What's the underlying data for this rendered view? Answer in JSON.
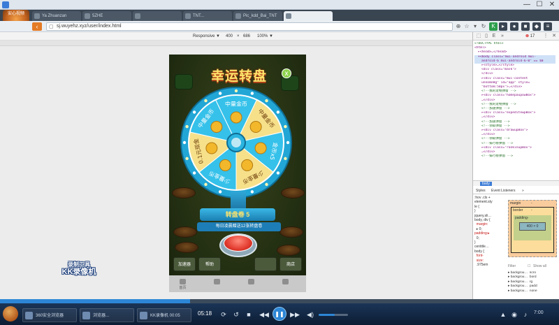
{
  "os": {
    "title_left": "",
    "win_controls": [
      "—",
      "☐",
      "✕"
    ]
  },
  "browser": {
    "logo_line1": "安心视频",
    "tabs": [
      {
        "label": "Ya Zhuanzan"
      },
      {
        "label": "5ZHE"
      },
      {
        "label": ""
      },
      {
        "label": "TNT..."
      },
      {
        "label": "Pic_kdd_Bai_TNT"
      },
      {
        "label": ""
      }
    ],
    "url": "sj.wuyehz.xyz/user/index.html",
    "back_label": "‹",
    "fwd_label": "›"
  },
  "device_toolbar": {
    "preset": "Responsive ▼",
    "width": "400",
    "times": "×",
    "height": "686",
    "zoom": "100% ▼"
  },
  "game": {
    "title": "幸运转盘",
    "close_label": "x",
    "segments": [
      "中量金币",
      "中量金币",
      "金币x5",
      "少量金币",
      "少量金币",
      "0.1元现金",
      "中量金币"
    ],
    "pointer_label": "",
    "stage_label": "转盘卷 5",
    "hint": "每日凌晨赠送12张转盘卷",
    "bottom_buttons": [
      "加速器",
      "帮助",
      "",
      "",
      "商店"
    ],
    "nav": [
      "首页",
      "",
      "",
      ""
    ]
  },
  "watermark": {
    "line1": "录制工具",
    "line2": "KK录像机"
  },
  "devtools": {
    "error_count": "17",
    "tree": [
      {
        "t": "<!DOCTYPE html>",
        "c": "cmt",
        "indent": 0
      },
      {
        "t": "<html>",
        "c": "tag",
        "indent": 0
      },
      {
        "t": "▸<head>…</head>",
        "c": "tag",
        "indent": 1
      },
      {
        "t": "▾<body class=\"mui-android mui-",
        "c": "tag",
        "indent": 1,
        "sel": true
      },
      {
        "t": "android-6 mui-android-6-0\" == $0",
        "c": "tag",
        "indent": 2,
        "sel": true
      },
      {
        "t": "▸<style>…</style>",
        "c": "tag",
        "indent": 2
      },
      {
        "t": "<div class=\"mask\">",
        "c": "tag",
        "indent": 2
      },
      {
        "t": "",
        "c": "tag",
        "indent": 2
      },
      {
        "t": "</div>",
        "c": "tag",
        "indent": 2
      },
      {
        "t": "▸<div class=\"mui-content",
        "c": "tag",
        "indent": 2
      },
      {
        "t": "unnome8g\" id=\"app\" style=",
        "c": "tag",
        "indent": 2
      },
      {
        "t": "\"bottom:50px\">…</div>",
        "c": "tag",
        "indent": 2
      },
      {
        "t": "<!--我的宠物弹窗 -->",
        "c": "cmt",
        "indent": 2
      },
      {
        "t": "▸<div class=\"homepaupowBox\">",
        "c": "tag",
        "indent": 2
      },
      {
        "t": "…</div>",
        "c": "tag",
        "indent": 2
      },
      {
        "t": "<!--我的宠物弹窗 -->",
        "c": "cmt",
        "indent": 2
      },
      {
        "t": "<!--加速弹窗 -->",
        "c": "cmt",
        "indent": 2
      },
      {
        "t": "▸<div class=\"expeditewpBox\">",
        "c": "tag",
        "indent": 2
      },
      {
        "t": "…</div>",
        "c": "tag",
        "indent": 2
      },
      {
        "t": "<!--加速弹窗 -->",
        "c": "cmt",
        "indent": 2
      },
      {
        "t": "<!--领取弹窗 -->",
        "c": "cmt",
        "indent": 2
      },
      {
        "t": "▸<div class=\"drawupBox\">",
        "c": "tag",
        "indent": 2
      },
      {
        "t": "…</div>",
        "c": "tag",
        "indent": 2
      },
      {
        "t": "<!--领取弹窗 -->",
        "c": "cmt",
        "indent": 2
      },
      {
        "t": "<!--排行榜弹窗 -->",
        "c": "cmt",
        "indent": 2
      },
      {
        "t": "▸<div class=\"rankinupBox\">",
        "c": "tag",
        "indent": 2
      },
      {
        "t": "…</div>",
        "c": "tag",
        "indent": 2
      },
      {
        "t": "<!--排行榜弹窗 -->",
        "c": "cmt",
        "indent": 2
      }
    ],
    "crumb": "body",
    "tab_styles": "Styles",
    "tab_listeners": "Event Listeners",
    "tab_more": "»",
    "styles_lines": [
      {
        "t": ":hov .cls +",
        "p": false
      },
      {
        "t": "element.sty",
        "p": false
      },
      {
        "t": "le {",
        "p": false
      },
      {
        "t": "}",
        "p": false
      },
      {
        "t": "jquery.sli…",
        "p": false
      },
      {
        "t": "body, div {",
        "p": false
      },
      {
        "t": "  margin:",
        "p": true
      },
      {
        "t": "  ▸ 0;",
        "p": false
      },
      {
        "t": "",
        "p": false
      },
      {
        "t": "padding:▸",
        "p": true
      },
      {
        "t": "  0;",
        "p": false
      },
      {
        "t": "}",
        "p": false
      },
      {
        "t": "centitle…",
        "p": false
      },
      {
        "t": "body {",
        "p": false
      },
      {
        "t": "  font-",
        "p": true
      },
      {
        "t": "  size:",
        "p": true
      },
      {
        "t": "  .975em",
        "p": false
      }
    ],
    "box": {
      "margin": "margin",
      "border": "border",
      "padding": "padding-",
      "content": "400 × 0",
      "dash": "-"
    },
    "filter": "Filter",
    "show_all": "Show all",
    "computed": [
      "▸ backgrou…  scro",
      "▸ backgrou…  bord",
      "▸ backgrou…  rg",
      "▸ backgrou…  padd",
      "▸ backgrou…  none"
    ]
  },
  "player": {
    "time": "05:18",
    "tasks": [
      {
        "label": "360安全浏览器"
      },
      {
        "label": "浏览器..."
      },
      {
        "label": "KK录像机 00:05"
      }
    ],
    "tray_time": "7:00",
    "progress": 0.34,
    "volume": 0.55
  }
}
